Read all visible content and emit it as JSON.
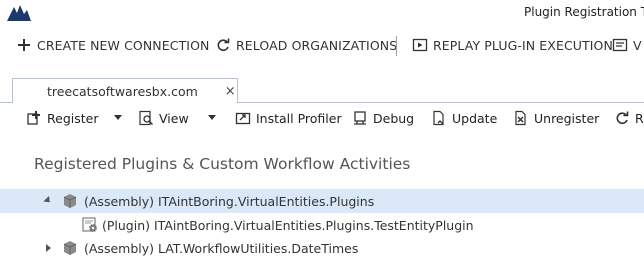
{
  "window": {
    "title": "Plugin Registration To"
  },
  "toolbar": {
    "create_connection": "CREATE NEW CONNECTION",
    "reload_organizations": "RELOAD ORGANIZATIONS",
    "replay_execution": "REPLAY PLUG-IN EXECUTION",
    "overflow": "V"
  },
  "tabs": [
    {
      "label": "treecatsoftwaresbx.com",
      "close": "×"
    }
  ],
  "actions": {
    "register": "Register",
    "view": "View",
    "install_profiler": "Install Profiler",
    "debug": "Debug",
    "update": "Update",
    "unregister": "Unregister",
    "refresh": "R"
  },
  "panel": {
    "title": "Registered Plugins & Custom Workflow Activities"
  },
  "tree": [
    {
      "label": "(Assembly) ITAintBoring.VirtualEntities.Plugins",
      "expanded": true,
      "selected": true
    },
    {
      "label": "(Plugin) ITAintBoring.VirtualEntities.Plugins.TestEntityPlugin"
    },
    {
      "label": "(Assembly) LAT.WorkflowUtilities.DateTimes",
      "expanded": false
    }
  ],
  "colors": {
    "selection": "#dbe8f7",
    "brand": "#1b3a6b"
  }
}
